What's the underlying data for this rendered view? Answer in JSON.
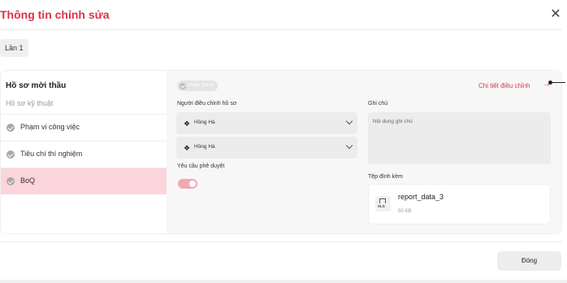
{
  "dialog": {
    "title": "Thông tin chỉnh sửa",
    "close_icon": "close-icon"
  },
  "revision_chip": "Lần 1",
  "left_nav": {
    "heading": "Hồ sơ mời thầu",
    "subheading": "Hồ sơ kỹ thuật",
    "items": [
      {
        "label": "Phạm vi công việc",
        "icon": "check-circle-icon"
      },
      {
        "label": "Tiêu chí thí nghiệm",
        "icon": "check-circle-icon"
      },
      {
        "label": "BoQ",
        "icon": "check-circle-icon",
        "active": true
      }
    ]
  },
  "detail": {
    "status_label": "Hoàn thành",
    "detail_link": "Chi tiết điều chỉnh",
    "detail_arrow": "→",
    "adjuster_label": "Người điều chỉnh hồ sơ",
    "adjusters": [
      "Hồng Hà",
      "Hồng Hà"
    ],
    "approval_label": "Yêu cầu phê duyệt",
    "approval_enabled": true,
    "note_label": "Ghi chú",
    "note_placeholder": "Nội dung ghi chú",
    "attachment_label": "Tệp đính kèm",
    "file": {
      "name": "report_data_3",
      "size": "50 KB",
      "type": "XLS"
    }
  },
  "footer": {
    "close_button": "Đóng"
  },
  "colors": {
    "accent": "#e03146",
    "active_row": "#fbd5da",
    "toggle_on": "#f2a8b1"
  }
}
